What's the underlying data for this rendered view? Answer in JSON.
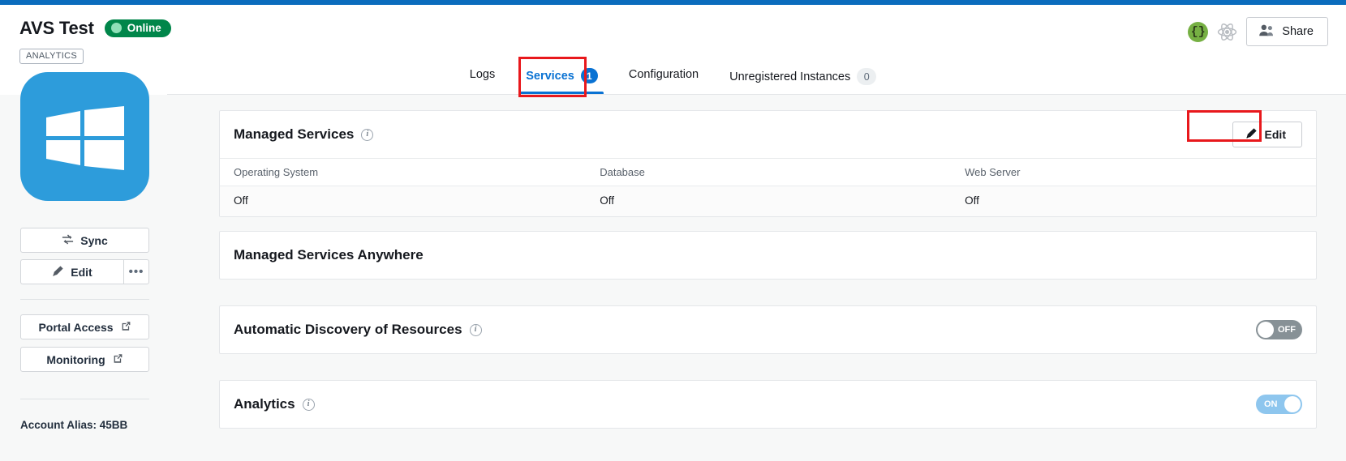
{
  "header": {
    "title": "AVS Test",
    "status": "Online",
    "tag": "ANALYTICS",
    "share_label": "Share",
    "brace_icon": "json-braces-icon",
    "atom_icon": "atom-icon"
  },
  "tabs": [
    {
      "label": "Logs",
      "badge": null,
      "active": false
    },
    {
      "label": "Services",
      "badge": "1",
      "active": true
    },
    {
      "label": "Configuration",
      "badge": null,
      "active": false
    },
    {
      "label": "Unregistered Instances",
      "badge": "0",
      "active": false
    }
  ],
  "sidebar": {
    "os_icon": "windows-logo",
    "sync_label": "Sync",
    "edit_label": "Edit",
    "more_label": "•••",
    "portal_access_label": "Portal Access",
    "monitoring_label": "Monitoring",
    "account_alias": "Account Alias: 45BB"
  },
  "cards": [
    {
      "title": "Managed Services",
      "has_info": true,
      "edit_label": "Edit",
      "table": {
        "columns": [
          "Operating System",
          "Database",
          "Web Server"
        ],
        "rows": [
          [
            "Off",
            "Off",
            "Off"
          ]
        ]
      }
    },
    {
      "title": "Managed Services Anywhere",
      "has_info": false
    },
    {
      "title": "Automatic Discovery of Resources",
      "has_info": true,
      "toggle": {
        "state": "off",
        "label": "OFF"
      }
    },
    {
      "title": "Analytics",
      "has_info": true,
      "toggle": {
        "state": "on",
        "label": "ON"
      }
    }
  ],
  "colors": {
    "topbar": "#0b6cbd",
    "accent": "#0972d3",
    "online": "#00864a",
    "highlight": "#e8181c",
    "tile": "#2d9cdb"
  }
}
